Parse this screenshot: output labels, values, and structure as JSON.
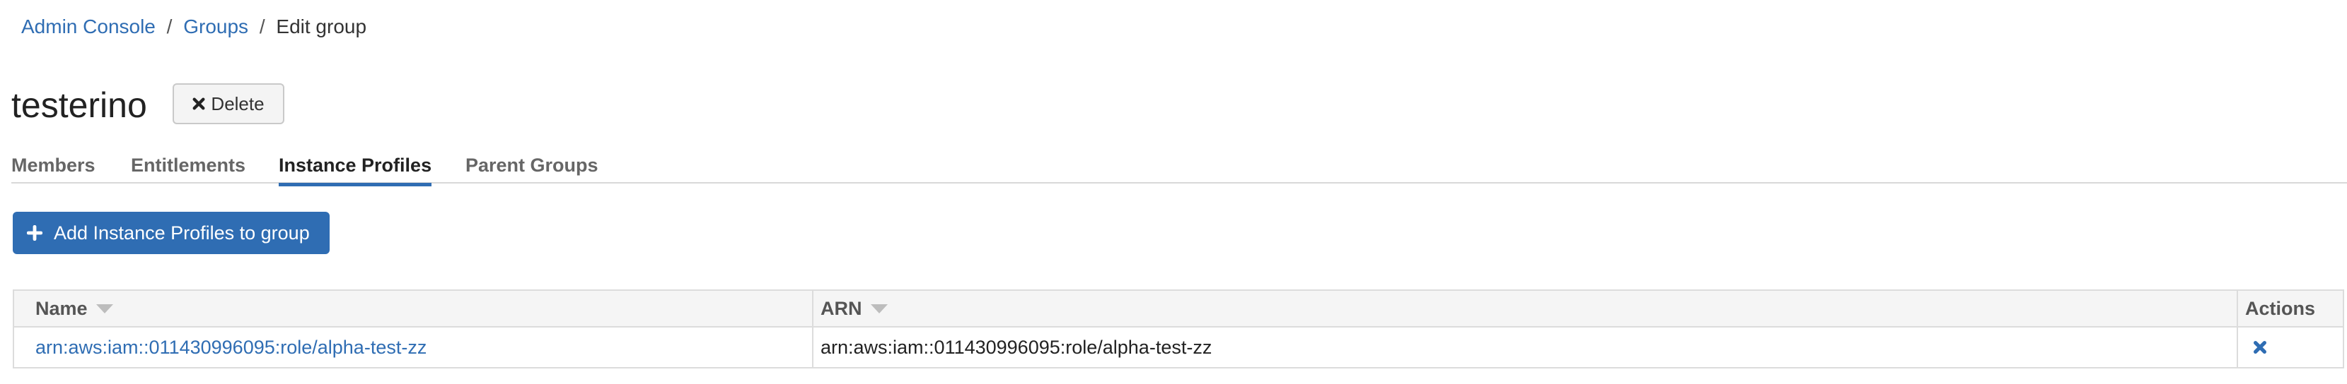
{
  "breadcrumb": {
    "items": [
      "Admin Console",
      "Groups"
    ],
    "separator": "/",
    "current": "Edit group"
  },
  "group": {
    "title": "testerino",
    "delete_label": "Delete"
  },
  "tabs": [
    {
      "label": "Members",
      "active": false
    },
    {
      "label": "Entitlements",
      "active": false
    },
    {
      "label": "Instance Profiles",
      "active": true
    },
    {
      "label": "Parent Groups",
      "active": false
    }
  ],
  "add_button": {
    "label": "Add Instance Profiles to group",
    "icon": "plus-icon"
  },
  "table": {
    "columns": [
      "Name",
      "ARN",
      "Actions"
    ],
    "rows": [
      {
        "name": "arn:aws:iam::011430996095:role/alpha-test-zz",
        "arn": "arn:aws:iam::011430996095:role/alpha-test-zz",
        "action_icon": "remove-icon"
      }
    ]
  },
  "colors": {
    "primary": "#2f6db3",
    "tab_active_underline": "#2f6db3",
    "border": "#dcdcdc",
    "header_bg": "#f5f5f5"
  }
}
